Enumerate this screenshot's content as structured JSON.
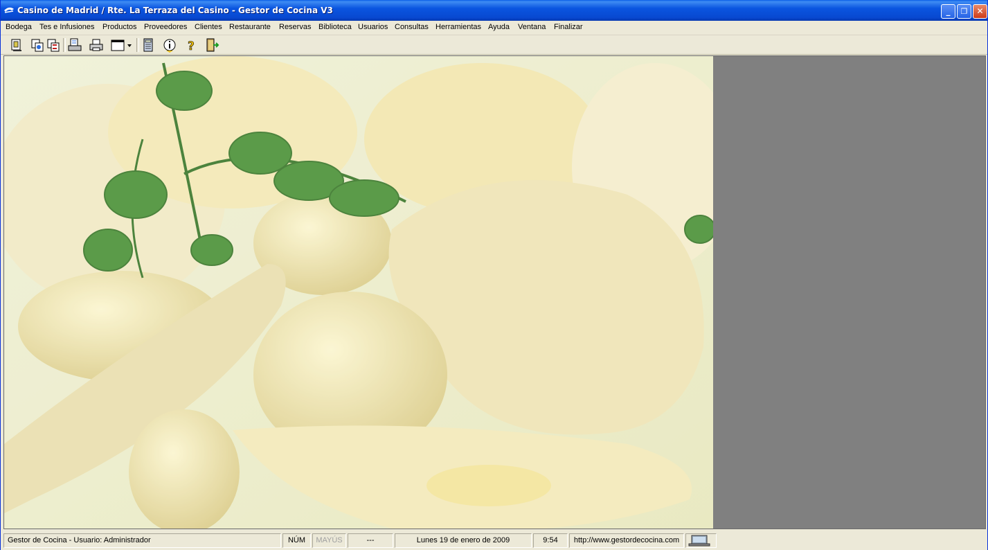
{
  "window": {
    "title": "Casino de Madrid / Rte. La Terraza del Casino - Gestor de Cocina V3",
    "controls": {
      "minimize": "_",
      "maximize": "❐",
      "close": "✕"
    }
  },
  "menu": [
    "Bodega",
    "Tes e Infusiones",
    "Productos",
    "Proveedores",
    "Clientes",
    "Restaurante",
    "Reservas",
    "Biblioteca",
    "Usuarios",
    "Consultas",
    "Herramientas",
    "Ayuda",
    "Ventana",
    "Finalizar"
  ],
  "toolbar": {
    "icons": [
      "glass-icon",
      "copy-icon",
      "swap-icon",
      "report-icon",
      "print-icon",
      "window-icon",
      "calculator-icon",
      "info-icon",
      "help-icon",
      "exit-icon"
    ]
  },
  "main": {
    "background_image": "food-photo"
  },
  "statusbar": {
    "app_user": "Gestor de Cocina - Usuario: Administrador",
    "num": "NÚM",
    "caps": "MAYÚS",
    "scroll": "---",
    "date": "Lunes 19 de enero de 2009",
    "time": "9:54",
    "url": "http://www.gestordecocina.com",
    "icon": "network-icon"
  },
  "colors": {
    "titlebar": "#0a55e0",
    "workspace": "#808080",
    "chrome": "#ece9d8",
    "close_button": "#cf3b1a"
  }
}
